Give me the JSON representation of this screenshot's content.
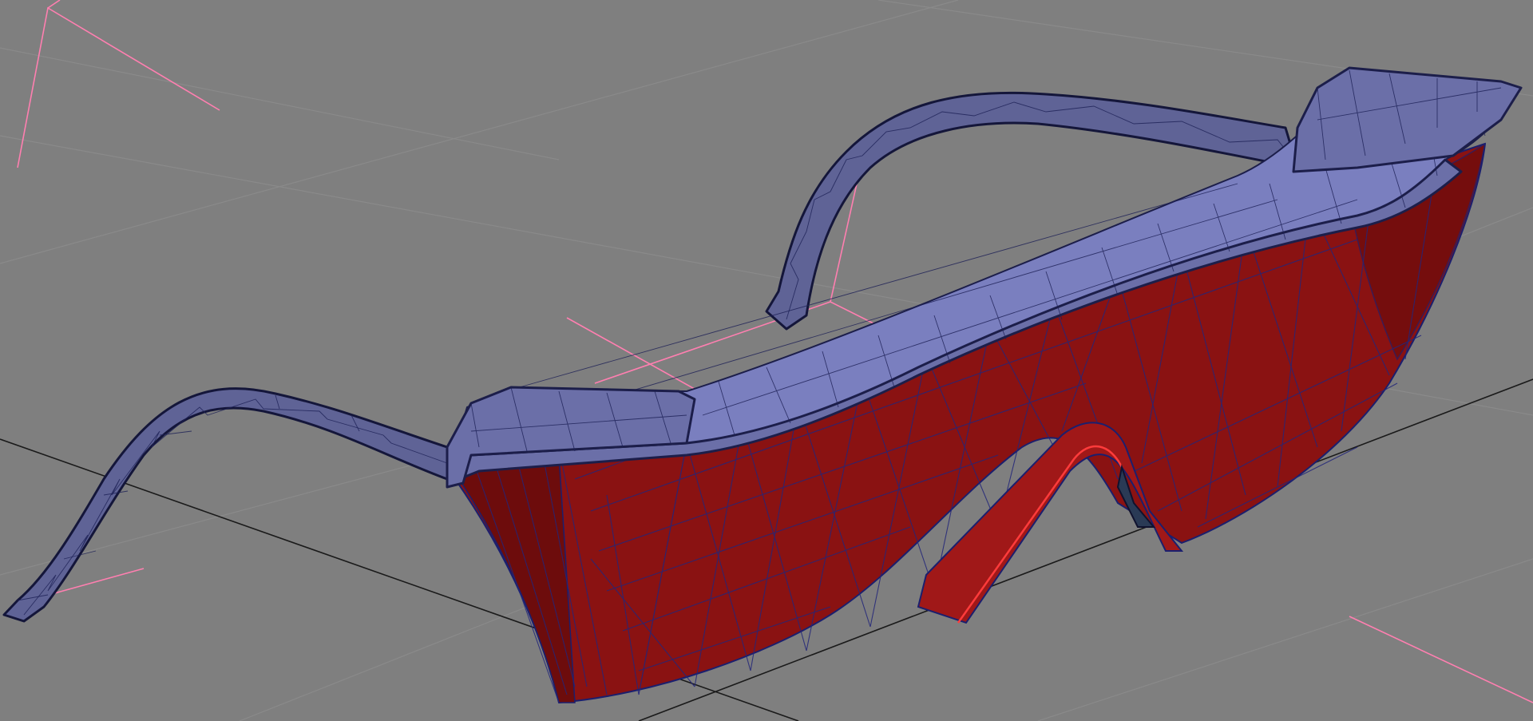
{
  "viewport": {
    "background_color": "#7f7f7f",
    "grid_color": "#8a8a8a",
    "axis_color": "#1a1a1a",
    "bounding_box_color": "#ff7fb0"
  },
  "model": {
    "object": "safety-glasses",
    "frame_color": "#6b6fa8",
    "lens_color": "#8a1212",
    "wireframe_color": "#23267a",
    "render_mode": "shaded-wireframe"
  }
}
